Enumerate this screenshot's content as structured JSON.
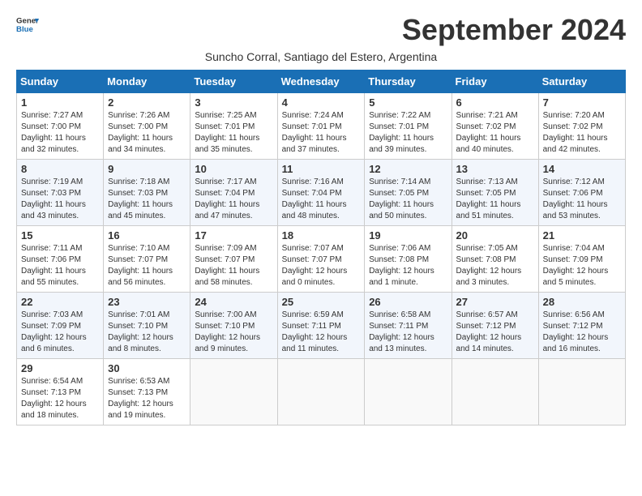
{
  "logo": {
    "general": "General",
    "blue": "Blue"
  },
  "title": "September 2024",
  "subtitle": "Suncho Corral, Santiago del Estero, Argentina",
  "days_of_week": [
    "Sunday",
    "Monday",
    "Tuesday",
    "Wednesday",
    "Thursday",
    "Friday",
    "Saturday"
  ],
  "weeks": [
    [
      {
        "day": "1",
        "info": "Sunrise: 7:27 AM\nSunset: 7:00 PM\nDaylight: 11 hours\nand 32 minutes."
      },
      {
        "day": "2",
        "info": "Sunrise: 7:26 AM\nSunset: 7:00 PM\nDaylight: 11 hours\nand 34 minutes."
      },
      {
        "day": "3",
        "info": "Sunrise: 7:25 AM\nSunset: 7:01 PM\nDaylight: 11 hours\nand 35 minutes."
      },
      {
        "day": "4",
        "info": "Sunrise: 7:24 AM\nSunset: 7:01 PM\nDaylight: 11 hours\nand 37 minutes."
      },
      {
        "day": "5",
        "info": "Sunrise: 7:22 AM\nSunset: 7:01 PM\nDaylight: 11 hours\nand 39 minutes."
      },
      {
        "day": "6",
        "info": "Sunrise: 7:21 AM\nSunset: 7:02 PM\nDaylight: 11 hours\nand 40 minutes."
      },
      {
        "day": "7",
        "info": "Sunrise: 7:20 AM\nSunset: 7:02 PM\nDaylight: 11 hours\nand 42 minutes."
      }
    ],
    [
      {
        "day": "8",
        "info": "Sunrise: 7:19 AM\nSunset: 7:03 PM\nDaylight: 11 hours\nand 43 minutes."
      },
      {
        "day": "9",
        "info": "Sunrise: 7:18 AM\nSunset: 7:03 PM\nDaylight: 11 hours\nand 45 minutes."
      },
      {
        "day": "10",
        "info": "Sunrise: 7:17 AM\nSunset: 7:04 PM\nDaylight: 11 hours\nand 47 minutes."
      },
      {
        "day": "11",
        "info": "Sunrise: 7:16 AM\nSunset: 7:04 PM\nDaylight: 11 hours\nand 48 minutes."
      },
      {
        "day": "12",
        "info": "Sunrise: 7:14 AM\nSunset: 7:05 PM\nDaylight: 11 hours\nand 50 minutes."
      },
      {
        "day": "13",
        "info": "Sunrise: 7:13 AM\nSunset: 7:05 PM\nDaylight: 11 hours\nand 51 minutes."
      },
      {
        "day": "14",
        "info": "Sunrise: 7:12 AM\nSunset: 7:06 PM\nDaylight: 11 hours\nand 53 minutes."
      }
    ],
    [
      {
        "day": "15",
        "info": "Sunrise: 7:11 AM\nSunset: 7:06 PM\nDaylight: 11 hours\nand 55 minutes."
      },
      {
        "day": "16",
        "info": "Sunrise: 7:10 AM\nSunset: 7:07 PM\nDaylight: 11 hours\nand 56 minutes."
      },
      {
        "day": "17",
        "info": "Sunrise: 7:09 AM\nSunset: 7:07 PM\nDaylight: 11 hours\nand 58 minutes."
      },
      {
        "day": "18",
        "info": "Sunrise: 7:07 AM\nSunset: 7:07 PM\nDaylight: 12 hours\nand 0 minutes."
      },
      {
        "day": "19",
        "info": "Sunrise: 7:06 AM\nSunset: 7:08 PM\nDaylight: 12 hours\nand 1 minute."
      },
      {
        "day": "20",
        "info": "Sunrise: 7:05 AM\nSunset: 7:08 PM\nDaylight: 12 hours\nand 3 minutes."
      },
      {
        "day": "21",
        "info": "Sunrise: 7:04 AM\nSunset: 7:09 PM\nDaylight: 12 hours\nand 5 minutes."
      }
    ],
    [
      {
        "day": "22",
        "info": "Sunrise: 7:03 AM\nSunset: 7:09 PM\nDaylight: 12 hours\nand 6 minutes."
      },
      {
        "day": "23",
        "info": "Sunrise: 7:01 AM\nSunset: 7:10 PM\nDaylight: 12 hours\nand 8 minutes."
      },
      {
        "day": "24",
        "info": "Sunrise: 7:00 AM\nSunset: 7:10 PM\nDaylight: 12 hours\nand 9 minutes."
      },
      {
        "day": "25",
        "info": "Sunrise: 6:59 AM\nSunset: 7:11 PM\nDaylight: 12 hours\nand 11 minutes."
      },
      {
        "day": "26",
        "info": "Sunrise: 6:58 AM\nSunset: 7:11 PM\nDaylight: 12 hours\nand 13 minutes."
      },
      {
        "day": "27",
        "info": "Sunrise: 6:57 AM\nSunset: 7:12 PM\nDaylight: 12 hours\nand 14 minutes."
      },
      {
        "day": "28",
        "info": "Sunrise: 6:56 AM\nSunset: 7:12 PM\nDaylight: 12 hours\nand 16 minutes."
      }
    ],
    [
      {
        "day": "29",
        "info": "Sunrise: 6:54 AM\nSunset: 7:13 PM\nDaylight: 12 hours\nand 18 minutes."
      },
      {
        "day": "30",
        "info": "Sunrise: 6:53 AM\nSunset: 7:13 PM\nDaylight: 12 hours\nand 19 minutes."
      },
      {
        "day": "",
        "info": ""
      },
      {
        "day": "",
        "info": ""
      },
      {
        "day": "",
        "info": ""
      },
      {
        "day": "",
        "info": ""
      },
      {
        "day": "",
        "info": ""
      }
    ]
  ]
}
